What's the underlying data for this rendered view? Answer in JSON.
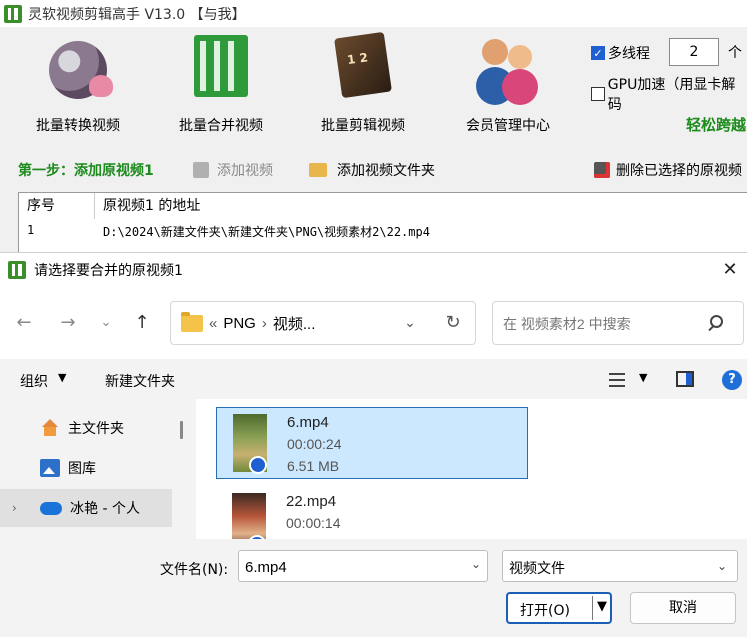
{
  "app": {
    "title": "灵软视频剪辑高手 V13.0  【与我】",
    "toolbar": [
      {
        "label": "批量转换视频"
      },
      {
        "label": "批量合并视频"
      },
      {
        "label": "批量剪辑视频"
      },
      {
        "label": "会员管理中心"
      }
    ],
    "multithread_label": "多线程",
    "multithread_value": "2",
    "multithread_unit": "个",
    "gpu_label": "GPU加速（用显卡解码",
    "promo_text": "轻松跨越",
    "step_label": "第一步：添加原视频1",
    "add_video_label": "添加视频",
    "add_folder_label": "添加视频文件夹",
    "delete_selected_label": "删除已选择的原视频",
    "table": {
      "col_index": "序号",
      "col_path": "原视频1 的地址",
      "rows": [
        {
          "index": "1",
          "path": "D:\\2024\\新建文件夹\\新建文件夹\\PNG\\视频素材2\\22.mp4"
        }
      ]
    }
  },
  "dialog": {
    "title": "请选择要合并的原视频1",
    "address": {
      "overflow": "«",
      "segment1": "PNG",
      "sep": "›",
      "segment2": "视频..."
    },
    "search_placeholder": "在 视频素材2 中搜索",
    "organize_label": "组织",
    "new_folder_label": "新建文件夹",
    "help_label": "?",
    "sidebar": [
      {
        "label": "主文件夹"
      },
      {
        "label": "图库"
      },
      {
        "label": "冰艳 - 个人"
      }
    ],
    "files": [
      {
        "name": "6.mp4",
        "duration": "00:00:24",
        "size": "6.51 MB",
        "selected": true
      },
      {
        "name": "22.mp4",
        "duration": "00:00:14",
        "size": "",
        "selected": false
      }
    ],
    "filename_label": "文件名(N):",
    "filename_value": "6.mp4",
    "filetype_value": "视频文件",
    "open_label": "打开(O)",
    "cancel_label": "取消"
  },
  "colors": {
    "accent": "#1f5fd1",
    "green_text": "#1c8a1c",
    "selection_bg": "#cce8ff"
  }
}
